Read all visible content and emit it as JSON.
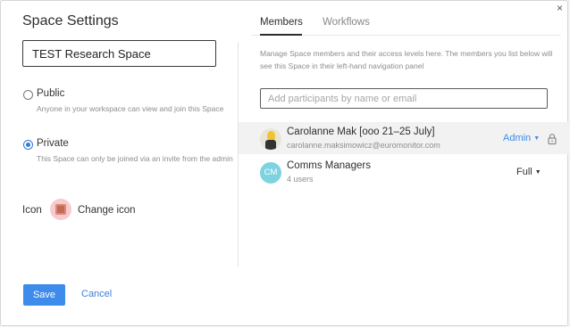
{
  "dialog": {
    "title": "Space Settings",
    "close_glyph": "×"
  },
  "space": {
    "name": "TEST Research Space",
    "visibility_options": [
      {
        "label": "Public",
        "description": "Anyone in your workspace can view and join this Space",
        "selected": false
      },
      {
        "label": "Private",
        "description": "This Space can only be joined via an invite from the admin",
        "selected": true
      }
    ],
    "icon_label": "Icon",
    "change_icon_label": "Change icon"
  },
  "footer": {
    "save_label": "Save",
    "cancel_label": "Cancel"
  },
  "tabs": [
    {
      "label": "Members",
      "active": true
    },
    {
      "label": "Workflows",
      "active": false
    }
  ],
  "members_panel": {
    "info": "Manage Space members and their access levels here. The members you list below will see this Space in their left-hand navigation panel",
    "search_placeholder": "Add participants by name or email",
    "members": [
      {
        "name": "Carolanne Mak [ooo 21–25 July]",
        "sub": "carolanne.maksimowicz@euromonitor.com",
        "role": "Admin",
        "locked": true
      },
      {
        "initials": "CM",
        "name": "Comms Managers",
        "sub": "4 users",
        "role": "Full",
        "locked": false
      }
    ]
  },
  "colors": {
    "accent": "#3d8bea",
    "avatar_group": "#7fd3e0",
    "icon_swatch": "#f8c9cf"
  }
}
